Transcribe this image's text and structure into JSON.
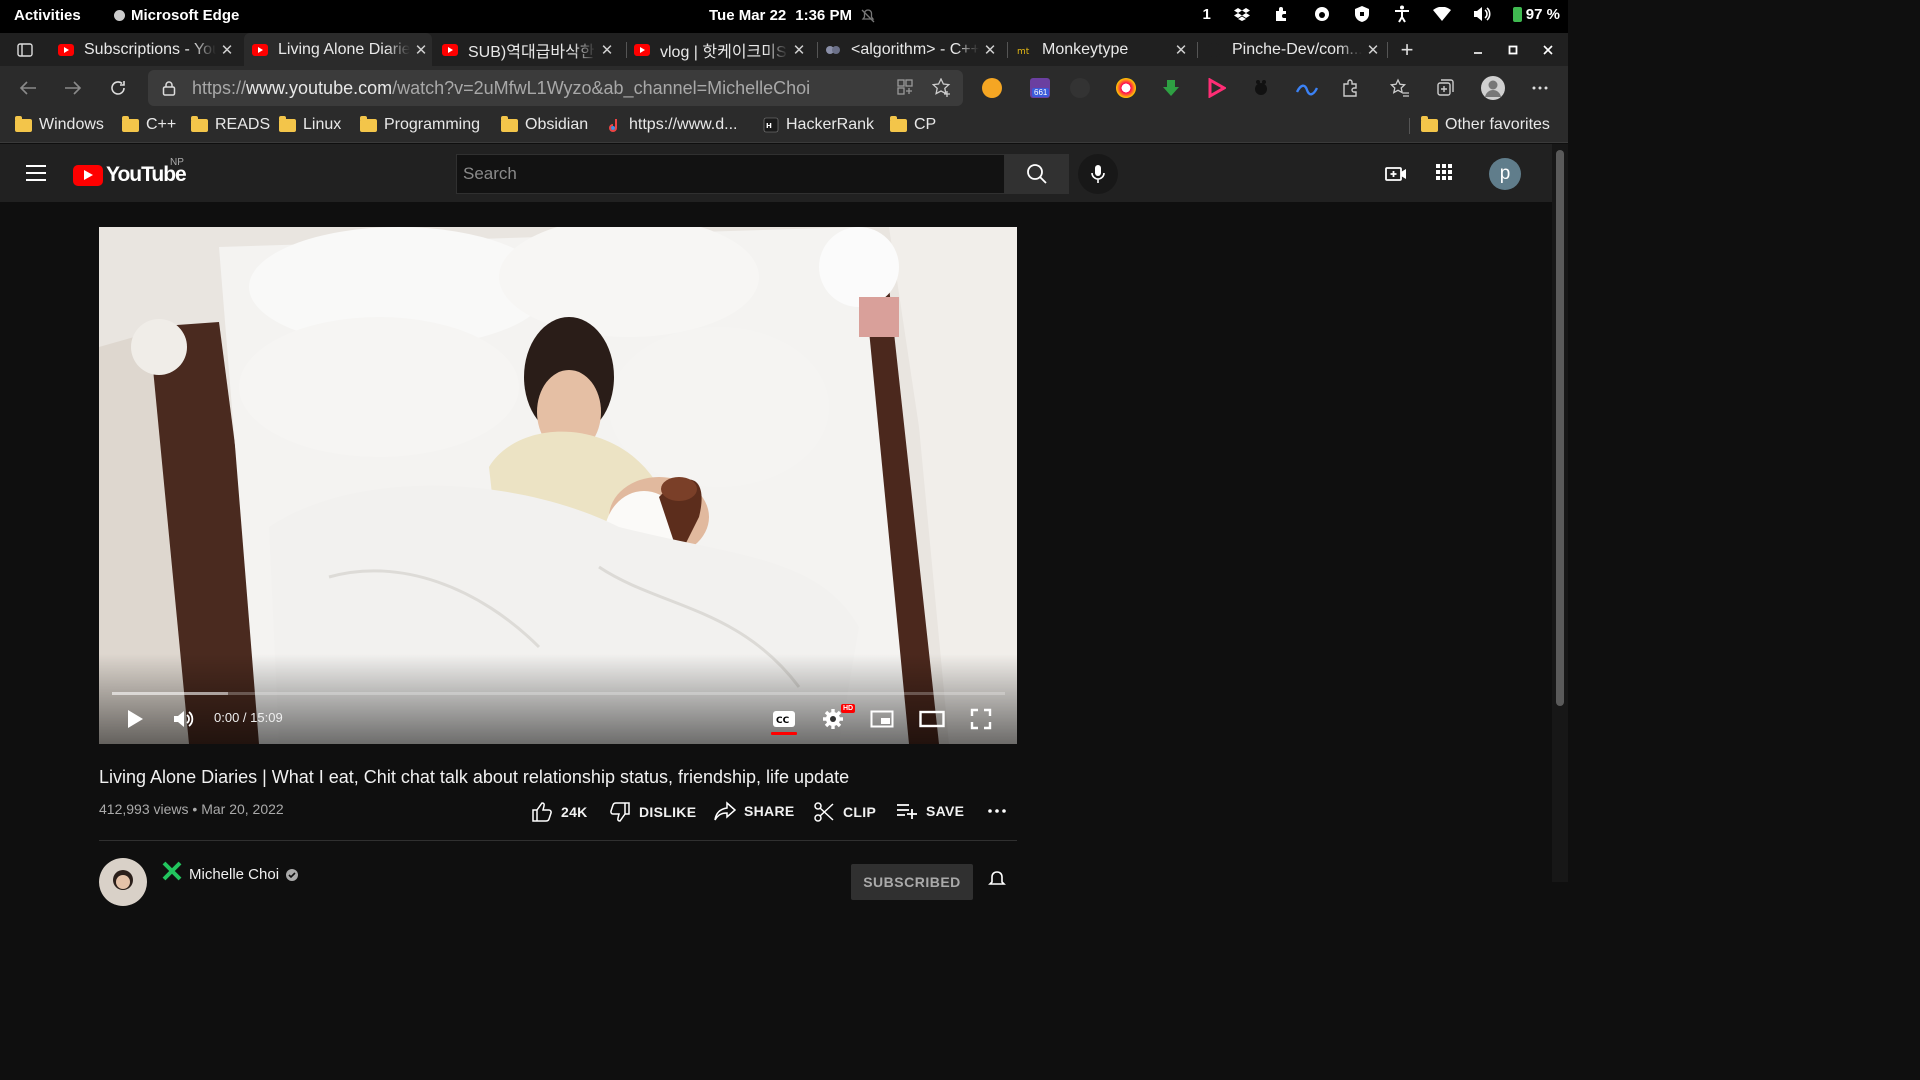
{
  "system_bar": {
    "activities": "Activities",
    "app_name": "Microsoft Edge",
    "date": "Tue Mar 22",
    "time": "1:36 PM",
    "workspace": "1",
    "battery": "97 %"
  },
  "tabs": [
    {
      "title": "Subscriptions - YouTube",
      "icon": "youtube-icon"
    },
    {
      "title": "Living Alone Diaries",
      "icon": "youtube-icon",
      "active": true
    },
    {
      "title": "SUB)역대급바삭한",
      "icon": "youtube-icon"
    },
    {
      "title": "vlog | 핫케이크미S",
      "icon": "youtube-icon"
    },
    {
      "title": "<algorithm> - C++",
      "icon": "cpp-reference-icon"
    },
    {
      "title": "Monkeytype",
      "icon": "monkeytype-icon"
    },
    {
      "title": "Pinche-Dev/com...",
      "icon": "github-icon"
    }
  ],
  "address_bar": {
    "url_prefix": "https://",
    "url_host": "www.youtube.com",
    "url_path": "/watch?v=2uMfwL1Wyzo&ab_channel=MichelleChoi",
    "extension_badge": "661"
  },
  "favorites": [
    {
      "label": "Windows",
      "type": "folder"
    },
    {
      "label": "C++",
      "type": "folder"
    },
    {
      "label": "READS",
      "type": "folder"
    },
    {
      "label": "Linux",
      "type": "folder"
    },
    {
      "label": "Programming",
      "type": "folder"
    },
    {
      "label": "Obsidian",
      "type": "folder"
    },
    {
      "label": "https://www.d...",
      "type": "link"
    },
    {
      "label": "HackerRank",
      "type": "link"
    },
    {
      "label": "CP",
      "type": "folder"
    }
  ],
  "other_favorites": "Other favorites",
  "youtube": {
    "logo_text": "YouTube",
    "country": "NP",
    "search_placeholder": "Search",
    "avatar_letter": "p"
  },
  "player": {
    "time": "0:00 / 15:09",
    "buffered_fraction": 0.13,
    "hd_badge": "HD"
  },
  "video": {
    "title": "Living Alone Diaries | What I eat, Chit chat talk about relationship status, friendship, life update",
    "views": "412,993 views",
    "date": "Mar 20, 2022",
    "likes": "24K",
    "dislike": "DISLIKE",
    "share": "SHARE",
    "clip": "CLIP",
    "save": "SAVE"
  },
  "channel": {
    "name": "Michelle Choi",
    "subscribe_label": "SUBSCRIBED"
  },
  "colors": {
    "youtube_red": "#ff0000",
    "page_bg": "#0f0f0f",
    "header_bg": "#212121",
    "folder": "#f3c54a"
  }
}
